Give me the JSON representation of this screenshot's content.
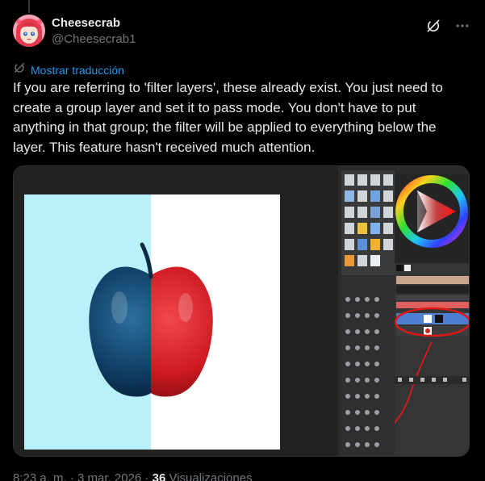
{
  "author": {
    "display_name": "Cheesecrab",
    "handle": "@Cheesecrab1"
  },
  "header_icons": [
    "grok-icon",
    "more-icon"
  ],
  "translate": {
    "label": "Mostrar traducción",
    "icon": "translate-icon"
  },
  "tweet": {
    "text": "If you are referring to 'filter layers', these already exist. You just need to create a group layer and set it to pass mode. You don't have to put anything in that group; the filter will be applied to everything below the layer. This feature hasn't received much attention."
  },
  "meta": {
    "time": "8:23 a. m.",
    "separator": "·",
    "date": "3 mar. 2026",
    "views_count": "36",
    "views_label": "Visualizaciones"
  },
  "colors": {
    "background": "#000000",
    "text": "#e7e9ea",
    "muted": "#71767b",
    "link": "#1d9bf0"
  }
}
